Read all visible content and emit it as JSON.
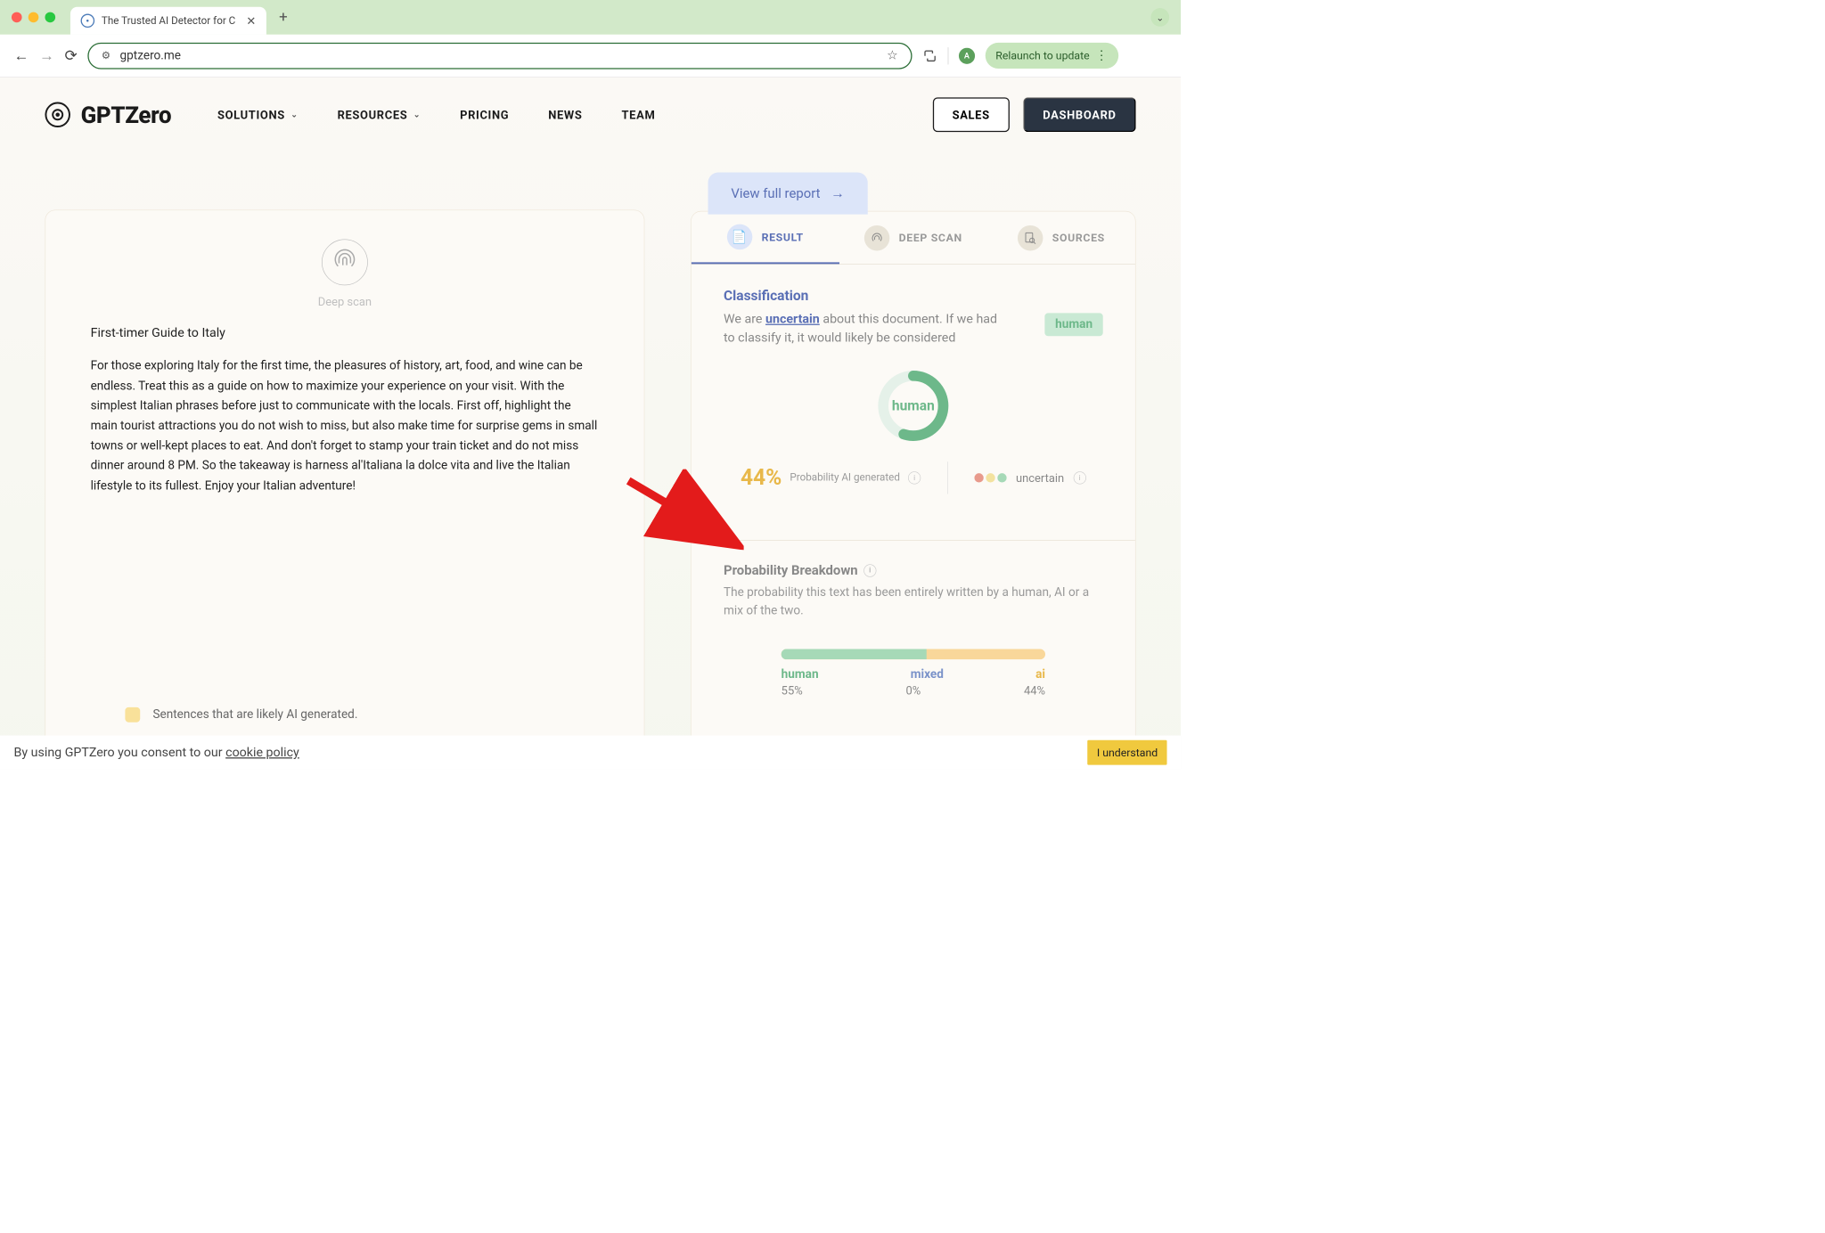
{
  "browser": {
    "tab_title": "The Trusted AI Detector for C",
    "url": "gptzero.me",
    "avatar_letter": "A",
    "relaunch_label": "Relaunch to update"
  },
  "header": {
    "logo_text": "GPTZero",
    "nav": {
      "solutions": "SOLUTIONS",
      "resources": "RESOURCES",
      "pricing": "PRICING",
      "news": "NEWS",
      "team": "TEAM"
    },
    "sales": "SALES",
    "dashboard": "DASHBOARD"
  },
  "left": {
    "deep_scan": "Deep scan",
    "doc_title": "First-timer Guide to Italy",
    "doc_body": "For those exploring Italy for the first time, the pleasures of history, art, food, and wine can be endless. Treat this as a guide on how to maximize your experience on your visit. With the simplest Italian phrases before just to communicate with the locals. First off, highlight the main tourist attractions you do not wish to miss, but also make time for surprise gems in small towns or well-kept places to eat. And don't forget to stamp your train ticket and do not miss dinner around 8 PM. So the takeaway is harness al'Italiana la dolce vita and live the Italian lifestyle to its fullest. Enjoy your Italian adventure!",
    "legend": "Sentences that are likely AI generated."
  },
  "right": {
    "report_link": "View full report",
    "tabs": {
      "result": "RESULT",
      "deep_scan": "DEEP SCAN",
      "sources": "SOURCES"
    },
    "classification": {
      "title": "Classification",
      "prefix": "We are ",
      "uncertain": "uncertain",
      "suffix": " about this document. If we had to classify it, it would likely be considered",
      "badge": "human",
      "donut_label": "human"
    },
    "probability": {
      "percent": "44%",
      "label": "Probability AI generated",
      "uncertain": "uncertain"
    },
    "breakdown": {
      "title": "Probability Breakdown",
      "desc": "The probability this text has been entirely written by a human, AI or a mix of the two.",
      "labels": {
        "human": "human",
        "mixed": "mixed",
        "ai": "ai"
      },
      "values": {
        "human": "55%",
        "mixed": "0%",
        "ai": "44%"
      }
    }
  },
  "cookie": {
    "text_prefix": "By using GPTZero you consent to our ",
    "link": "cookie policy",
    "button": "I understand"
  },
  "chart_data": {
    "type": "bar",
    "title": "Probability Breakdown",
    "categories": [
      "human",
      "mixed",
      "ai"
    ],
    "values": [
      55,
      0,
      44
    ],
    "ylim": [
      0,
      100
    ],
    "colors": {
      "human": "#a6d9b7",
      "mixed": "#c2d4e8",
      "ai": "#f9d79a"
    },
    "donut": {
      "label": "human",
      "human_pct": 55,
      "ai_pct": 44
    },
    "probability_ai": 44
  }
}
